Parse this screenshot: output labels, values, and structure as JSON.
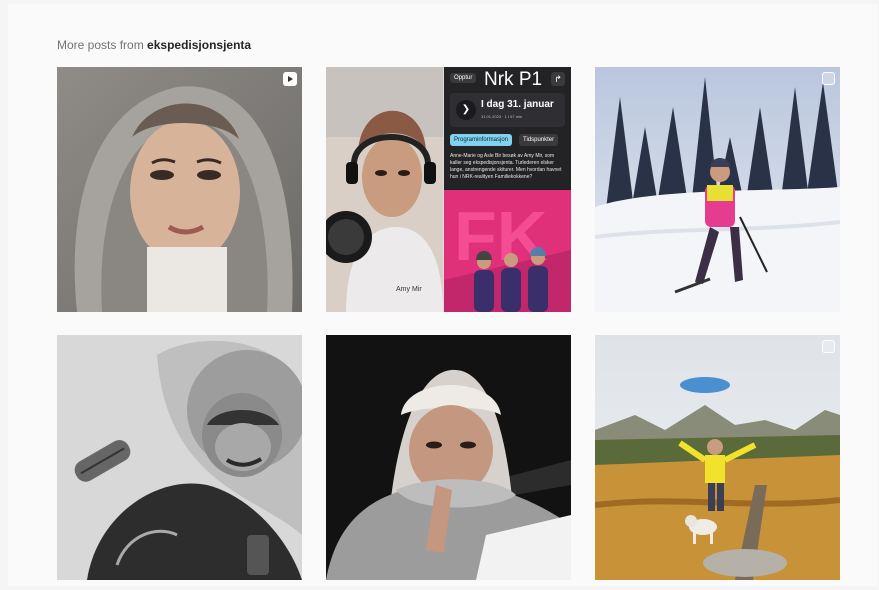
{
  "header": {
    "prefix": "More posts from",
    "username": "ekspedisjonsjenta"
  },
  "posts": [
    {
      "description": "",
      "badge": "reel-icon"
    },
    {
      "description": "",
      "badge": "none"
    },
    {
      "description": "",
      "badge": "carousel-icon"
    },
    {
      "description": "",
      "badge": "none"
    },
    {
      "description": "",
      "badge": "none"
    },
    {
      "description": "",
      "badge": "carousel-icon"
    }
  ],
  "radio_screen": {
    "opptur": "Opptur",
    "channel": "Nrk P1",
    "share_glyph": "↱",
    "date": "I dag 31. januar",
    "time": "31.01.2023 · 1 t 57 min",
    "tab_info": "Programinformasjon",
    "tab_times": "Tidspunkter",
    "description": "Anne-Marie og Asle Bir besøk av Amy Mir, som kaller seg ekspedisjonsjenta. Turlederen elsker lange, anstrengende skiturer. Men hvordan havnet hun i NRK-realityen Familiekokkene?",
    "mic_label": "Amy Mir"
  },
  "colors": {
    "background": "#fafafa",
    "heading_muted": "#737373",
    "heading_bold": "#262626",
    "nrk_dark": "#232326",
    "nrk_tab_active": "#7fd3ee",
    "fk_pink": "#e0307a"
  }
}
